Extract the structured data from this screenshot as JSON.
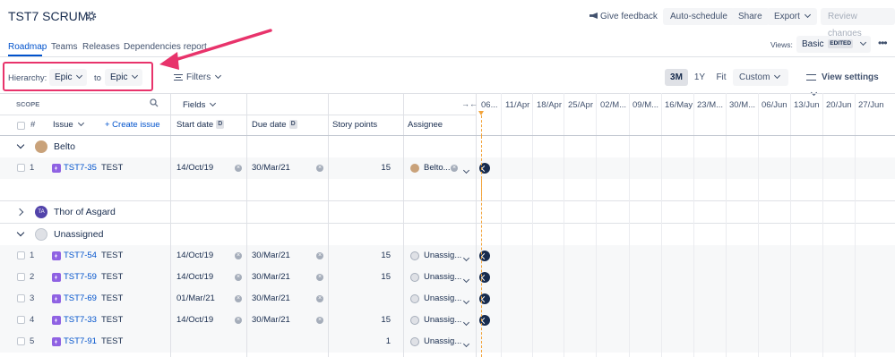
{
  "header": {
    "title": "TST7 SCRUM",
    "give_feedback": "Give feedback",
    "auto_schedule": "Auto-schedule",
    "share": "Share",
    "export": "Export",
    "review_changes": "Review changes"
  },
  "tabs": [
    {
      "label": "Roadmap",
      "active": true
    },
    {
      "label": "Teams"
    },
    {
      "label": "Releases"
    },
    {
      "label": "Dependencies report"
    }
  ],
  "views": {
    "label": "Views:",
    "value": "Basic",
    "badge": "EDITED"
  },
  "toolbar": {
    "hierarchy_label": "Hierarchy:",
    "hierarchy_from": "Epic",
    "to_label": "to",
    "hierarchy_to": "Epic",
    "filters": "Filters",
    "ranges": [
      "3M",
      "1Y",
      "Fit",
      "Custom"
    ],
    "active_range": "3M",
    "view_settings": "View settings"
  },
  "table": {
    "scope_label": "SCOPE",
    "fields_label": "Fields",
    "columns": {
      "number": "#",
      "issue": "Issue",
      "create_issue": "+ Create issue",
      "start_date": "Start date",
      "due_date": "Due date",
      "story_points": "Story points",
      "assignee": "Assignee",
      "date_badge": "D"
    }
  },
  "timeline": {
    "dates": [
      "06...",
      "11/Apr",
      "18/Apr",
      "25/Apr",
      "02/M...",
      "09/M...",
      "16/May",
      "23/M...",
      "30/M...",
      "06/Jun",
      "13/Jun",
      "20/Jun",
      "27/Jun"
    ]
  },
  "groups": [
    {
      "name": "Belto",
      "expanded": true,
      "rows": [
        {
          "num": "1",
          "key": "TST7-35",
          "summary": "TEST",
          "start": "14/Oct/19",
          "due": "30/Mar/21",
          "points": "15",
          "assignee": "Belto..."
        }
      ]
    },
    {
      "name": "Thor of Asgard",
      "initials": "TA",
      "expanded": false,
      "rows": []
    },
    {
      "name": "Unassigned",
      "expanded": true,
      "rows": [
        {
          "num": "1",
          "key": "TST7-54",
          "summary": "TEST",
          "start": "14/Oct/19",
          "due": "30/Mar/21",
          "points": "15",
          "assignee": "Unassig..."
        },
        {
          "num": "2",
          "key": "TST7-59",
          "summary": "TEST",
          "start": "14/Oct/19",
          "due": "30/Mar/21",
          "points": "15",
          "assignee": "Unassig..."
        },
        {
          "num": "3",
          "key": "TST7-69",
          "summary": "TEST",
          "start": "01/Mar/21",
          "due": "30/Mar/21",
          "points": "",
          "assignee": "Unassig..."
        },
        {
          "num": "4",
          "key": "TST7-33",
          "summary": "TEST",
          "start": "14/Oct/19",
          "due": "30/Mar/21",
          "points": "15",
          "assignee": "Unassig..."
        },
        {
          "num": "5",
          "key": "TST7-91",
          "summary": "TEST",
          "start": "",
          "due": "",
          "points": "1",
          "assignee": "Unassig..."
        }
      ]
    }
  ],
  "colors": {
    "accent": "#0052cc",
    "highlight": "#e8336b",
    "epic": "#8f62e3",
    "today": "#f2a33a"
  }
}
